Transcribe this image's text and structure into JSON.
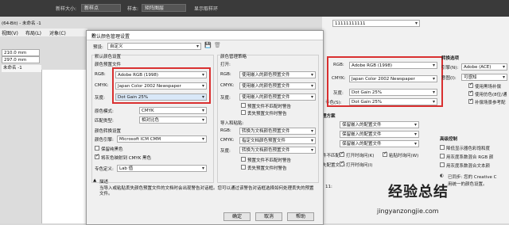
{
  "topbar": {
    "text_size_label": "新样大小:",
    "text_size_value": "新样点",
    "sample_label": "样本:",
    "sample_value": "矩阵图层",
    "show_ring": "显示取样环"
  },
  "app": {
    "window_title": "(64-Bit) - 未命名 -1",
    "doc_tab": "未命名 -1",
    "dims": [
      "210.0 mm",
      "297.0 mm"
    ],
    "menu": [
      "视图(V)",
      "布局(L)",
      "对象(C)"
    ]
  },
  "dialog": {
    "title": "默认颜色管理设置",
    "preset_label": "预设:",
    "preset_value": "自定义",
    "left": {
      "group1": "默认颜色设置",
      "group1_sub": "颜色预置文件",
      "rgb_label": "RGB:",
      "rgb_value": "Adobe RGB (1998)",
      "cmyk_label": "CMYK:",
      "cmyk_value": "Japan Color 2002 Newspaper",
      "gray_label": "灰度:",
      "gray_value": "Dot Gain 25%",
      "mode_label": "原色模式:",
      "mode_value": "CMYK",
      "match_label": "匹配类型:",
      "match_value": "相对比色",
      "group2": "颜色转换设置",
      "engine_label": "颜色引擎:",
      "engine_value": "Microsoft ICM CMM",
      "keep_black": "保留纯黑色",
      "map_gray": "将灰色映射到 CMYK 黑色",
      "spot_label": "专色定义:",
      "spot_value": "Lab 值"
    },
    "right": {
      "group": "颜色管理策略",
      "open_label": "打开:",
      "rgb_label": "RGB:",
      "rgb_value": "使用嵌入的颜色预置文件",
      "cmyk_label": "CMYK:",
      "cmyk_value": "使用嵌入的颜色预置文件",
      "gray_label": "灰度:",
      "gray_value": "使用嵌入的颜色预置文件",
      "warn1": "预置文件不匹配时警告",
      "warn2": "丢失预置文件时警告",
      "import_label": "导入和粘贴:",
      "rgb2_value": "转换为文档颜色预置文件",
      "cmyk2_value": "指定文档颜色预置文件",
      "gray2_value": "转换为文档颜色预置文件",
      "warn3": "预置文件不匹配时警告",
      "warn4": "丢失预置文件时警告"
    },
    "desc_title": "描述",
    "desc_text": "当导入或粘贴丢失颜色预置文件的文档时会出现警告对话框。您可以通过该警告对话框选择如何处理丢失的预置文件。",
    "ok": "确定",
    "cancel": "取消",
    "help": "帮助"
  },
  "right_panel": {
    "dropdown": "11111111111",
    "rgb_label": "RGB:",
    "rgb_value": "Adobe RGB (1998)",
    "cmyk_label": "CMYK:",
    "cmyk_value": "Japan Color 2002 Newspaper",
    "gray_label": "灰度:",
    "gray_value": "Dot Gain 25%",
    "spot_label": "专色(S):",
    "spot_value": "Dot Gain 25%",
    "conv_title": "转换选项",
    "engine_label": "引擎(N):",
    "engine_value": "Adobe (ACE)",
    "intent_label": "意图(I):",
    "intent_value": "可感知",
    "opt1": "使用黑场补偿",
    "opt2": "使用仿色(8位/通",
    "opt3": "补偿场景参考配",
    "policy_title": "理方案",
    "policy_value": "保留嵌入的配置文件",
    "policy2_value": "保留嵌入的配置文件",
    "policy3_value": "保留嵌入的配置文件",
    "mismatch_label": "件不匹配:",
    "open_ask": "打开时询问(K)",
    "paste_ask": "粘贴时询问(W)",
    "missing_label": "失配置文件:",
    "open_ask2": "打开时询问(I)",
    "adv_title": "高级控制",
    "adv1": "降低显示器色彩饱和度",
    "adv2": "用灰度系数混合 RGB 颜",
    "adv3": "用灰度系数混合文本颜",
    "sync": "已同步: 您的 Creative C",
    "sync2": "用统一的颜色设置。",
    "num": "11:"
  },
  "watermark": {
    "line1": "经验总结",
    "line2": "jingyanzongjie.com"
  },
  "colors": {
    "highlight_red": "#d93030",
    "topbar": "#3a3a3a"
  }
}
